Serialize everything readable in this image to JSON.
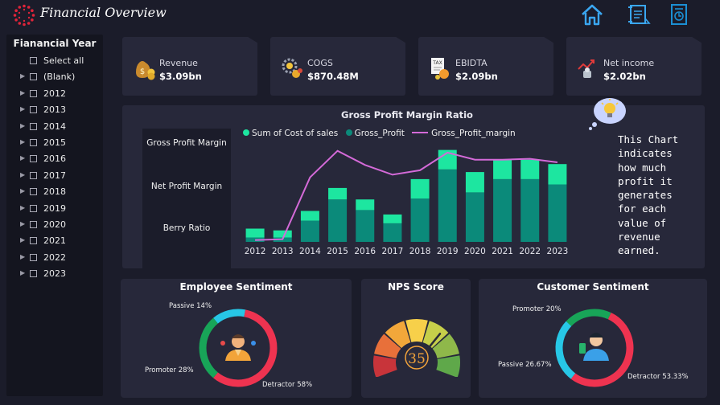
{
  "header": {
    "title": "Financial Overview",
    "icons": [
      "logo-ring-icon",
      "home-icon",
      "report-icon",
      "document-icon"
    ]
  },
  "sidebar": {
    "title": "Fianancial Year",
    "items": [
      {
        "label": "Select all",
        "expandable": false
      },
      {
        "label": "(Blank)",
        "expandable": true
      },
      {
        "label": "2012",
        "expandable": true
      },
      {
        "label": "2013",
        "expandable": true
      },
      {
        "label": "2014",
        "expandable": true
      },
      {
        "label": "2015",
        "expandable": true
      },
      {
        "label": "2016",
        "expandable": true
      },
      {
        "label": "2017",
        "expandable": true
      },
      {
        "label": "2018",
        "expandable": true
      },
      {
        "label": "2019",
        "expandable": true
      },
      {
        "label": "2020",
        "expandable": true
      },
      {
        "label": "2021",
        "expandable": true
      },
      {
        "label": "2022",
        "expandable": true
      },
      {
        "label": "2023",
        "expandable": true
      }
    ]
  },
  "kpis": [
    {
      "label": "Revenue",
      "value": "$3.09bn",
      "icon": "money-bag-icon"
    },
    {
      "label": "COGS",
      "value": "$870.48M",
      "icon": "gear-coins-icon"
    },
    {
      "label": "EBIDTA",
      "value": "$2.09bn",
      "icon": "tax-document-icon"
    },
    {
      "label": "Net income",
      "value": "$2.02bn",
      "icon": "growth-chart-icon"
    }
  ],
  "ratio_tabs": [
    "Gross Profit Margin",
    "Net Profit Margin",
    "Berry Ratio"
  ],
  "note": "This Chart indicates how much profit it generates for each value of revenue earned.",
  "colors": {
    "background": "#1b1c2a",
    "card": "#27283a",
    "cost_of_sales": "#0b8a7a",
    "gross_profit": "#1de6a0",
    "margin_line": "#d46ad8",
    "detractor": "#ee3350",
    "promoter": "#18a558",
    "passive": "#27c7e6"
  },
  "chart_data": {
    "type": "bar",
    "title": "Gross Profit Margin Ratio",
    "categories": [
      "2012",
      "2013",
      "2014",
      "2015",
      "2016",
      "2017",
      "2018",
      "2019",
      "2020",
      "2021",
      "2022",
      "2023"
    ],
    "series": [
      {
        "name": "Sum of Cost of sales",
        "kind": "stacked-bar",
        "values": [
          5,
          5,
          24,
          48,
          36,
          21,
          49,
          82,
          56,
          71,
          71,
          65
        ]
      },
      {
        "name": "Gross_Profit",
        "kind": "stacked-bar",
        "values": [
          10,
          8,
          11,
          13,
          12,
          10,
          22,
          22,
          23,
          22,
          22,
          23
        ]
      },
      {
        "name": "Gross_Profit_margin",
        "kind": "line",
        "values": [
          2,
          3,
          73,
          103,
          87,
          76,
          81,
          101,
          93,
          93,
          94,
          90
        ]
      }
    ],
    "legend": "top",
    "ylim": [
      0,
      110
    ],
    "grid": false
  },
  "employee_sentiment": {
    "title": "Employee Sentiment",
    "segments": [
      {
        "name": "Passive",
        "percent": 14,
        "label": "Passive 14%"
      },
      {
        "name": "Detractor",
        "percent": 58,
        "label": "Detractor 58%"
      },
      {
        "name": "Promoter",
        "percent": 28,
        "label": "Promoter 28%"
      }
    ]
  },
  "nps": {
    "title": "NPS Score",
    "value": "35",
    "score": 35
  },
  "customer_sentiment": {
    "title": "Customer Sentiment",
    "segments": [
      {
        "name": "Promoter",
        "percent": 20,
        "label": "Promoter 20%"
      },
      {
        "name": "Detractor",
        "percent": 53.33,
        "label": "Detractor 53.33%"
      },
      {
        "name": "Passive",
        "percent": 26.67,
        "label": "Passive 26.67%"
      }
    ]
  }
}
